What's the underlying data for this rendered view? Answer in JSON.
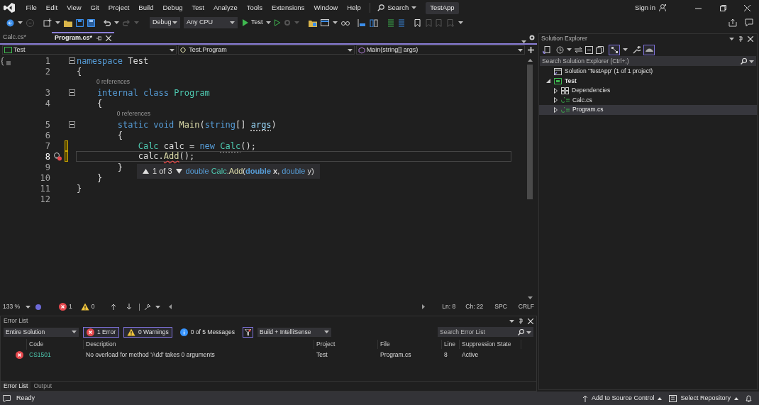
{
  "menu": [
    "File",
    "Edit",
    "View",
    "Git",
    "Project",
    "Build",
    "Debug",
    "Test",
    "Analyze",
    "Tools",
    "Extensions",
    "Window",
    "Help"
  ],
  "search": {
    "label": "Search"
  },
  "solution_badge": "TestApp",
  "sign_in": "Sign in",
  "toolbar": {
    "configuration": "Debug",
    "platform": "Any CPU",
    "run_target": "Test"
  },
  "editor": {
    "tabs": [
      {
        "label": "Calc.cs*",
        "selected": false
      },
      {
        "label": "Program.cs*",
        "selected": true
      }
    ],
    "nav": [
      "Test",
      "Test.Program",
      "Main(string[] args)"
    ],
    "lines": [
      {
        "number": "1",
        "fold": true,
        "tokens": [
          {
            "text": "namespace",
            "kind": "keyword"
          },
          {
            "text": " Test",
            "kind": "plain"
          }
        ]
      },
      {
        "number": "2",
        "tokens": [
          {
            "text": "{",
            "kind": "plain"
          }
        ]
      },
      {
        "number": "3",
        "fold": true,
        "codelens": "0 references",
        "tokens": [
          {
            "text": "    internal class",
            "kind": "keyword"
          },
          {
            "text": " Program",
            "kind": "type"
          }
        ]
      },
      {
        "number": "4",
        "tokens": [
          {
            "text": "    {",
            "kind": "plain"
          }
        ]
      },
      {
        "number": "5",
        "fold": true,
        "codelens": "0 references",
        "tokens": [
          {
            "text": "        static void",
            "kind": "keyword"
          },
          {
            "text": " Main",
            "kind": "method"
          },
          {
            "text": "(",
            "kind": "plain"
          },
          {
            "text": "string",
            "kind": "keyword"
          },
          {
            "text": "[] ",
            "kind": "plain"
          },
          {
            "text": "args",
            "kind": "parameter",
            "hint_underline": true
          },
          {
            "text": ")",
            "kind": "plain"
          }
        ]
      },
      {
        "number": "6",
        "tokens": [
          {
            "text": "        {",
            "kind": "plain"
          }
        ]
      },
      {
        "number": "7",
        "modified": true,
        "tokens": [
          {
            "text": "            Calc",
            "kind": "type"
          },
          {
            "text": " calc = ",
            "kind": "plain"
          },
          {
            "text": "new ",
            "kind": "keyword"
          },
          {
            "text": "Calc",
            "kind": "type",
            "hint_underline": true
          },
          {
            "text": "();",
            "kind": "plain"
          }
        ]
      },
      {
        "number": "8",
        "modified": true,
        "current": true,
        "error_bulb": true,
        "tokens": [
          {
            "text": "            calc.",
            "kind": "plain"
          },
          {
            "text": "Add",
            "kind": "method",
            "error_underline": true
          },
          {
            "text": "();",
            "kind": "plain"
          }
        ]
      },
      {
        "number": "9",
        "tokens": [
          {
            "text": "        }",
            "kind": "plain"
          }
        ]
      },
      {
        "number": "10",
        "tokens": [
          {
            "text": "    }",
            "kind": "plain"
          }
        ]
      },
      {
        "number": "11",
        "tokens": [
          {
            "text": "}",
            "kind": "plain"
          }
        ]
      },
      {
        "number": "12"
      }
    ],
    "parameter_info": {
      "counter": "1 of 3",
      "signature": [
        {
          "text": "double",
          "kind": "keyword",
          "bold": false
        },
        {
          "text": " Calc",
          "kind": "type",
          "bold": false
        },
        {
          "text": ".",
          "kind": "plain",
          "bold": false
        },
        {
          "text": "Add",
          "kind": "method",
          "bold": false
        },
        {
          "text": "(",
          "kind": "plain",
          "bold": false
        },
        {
          "text": "double",
          "kind": "keyword",
          "bold": true
        },
        {
          "text": " x",
          "kind": "plain",
          "bold": true
        },
        {
          "text": ", ",
          "kind": "plain",
          "bold": false
        },
        {
          "text": "double",
          "kind": "keyword",
          "bold": false
        },
        {
          "text": " y",
          "kind": "plain",
          "bold": false
        },
        {
          "text": ")",
          "kind": "plain",
          "bold": false
        }
      ]
    },
    "status": {
      "zoom": "133 %",
      "errors": "1",
      "warnings": "0",
      "line": "Ln: 8",
      "column": "Ch: 22",
      "whitespace": "SPC",
      "line_ending": "CRLF"
    }
  },
  "error_list": {
    "title": "Error List",
    "scope": "Entire Solution",
    "filters": [
      {
        "label": "1 Error",
        "kind": "error",
        "selected": true
      },
      {
        "label": "0 Warnings",
        "kind": "warning",
        "selected": true
      },
      {
        "label": "0 of 5 Messages",
        "kind": "info",
        "selected": false
      }
    ],
    "source": "Build + IntelliSense",
    "search": {
      "placeholder": "Search Error List"
    },
    "columns": [
      "Code",
      "Description",
      "Project",
      "File",
      "Line",
      "Suppression State"
    ],
    "rows": [
      {
        "kind": "error",
        "cells": [
          "CS1501",
          "No overload for method 'Add' takes 0 arguments",
          "Test",
          "Program.cs",
          "8",
          "Active"
        ]
      }
    ]
  },
  "bottom_tabs": [
    {
      "label": "Error List",
      "selected": true
    },
    {
      "label": "Output",
      "selected": false
    }
  ],
  "solution_explorer": {
    "title": "Solution Explorer",
    "search": {
      "placeholder": "Search Solution Explorer (Ctrl+;)"
    },
    "tree": [
      {
        "label": "Solution 'TestApp' (1 of 1 project)",
        "kind": "solution",
        "selected": false,
        "children": [
          {
            "label": "Test",
            "kind": "project",
            "expanded": true,
            "selected": false,
            "children": [
              {
                "label": "Dependencies",
                "kind": "dependencies",
                "expanded": false,
                "selected": false
              },
              {
                "label": "Calc.cs",
                "kind": "file",
                "expanded": false,
                "selected": false
              },
              {
                "label": "Program.cs",
                "kind": "file",
                "expanded": false,
                "selected": true
              }
            ]
          }
        ]
      }
    ]
  },
  "status_bar": {
    "state": "Ready",
    "items": [
      "Add to Source Control",
      "Select Repository"
    ]
  }
}
